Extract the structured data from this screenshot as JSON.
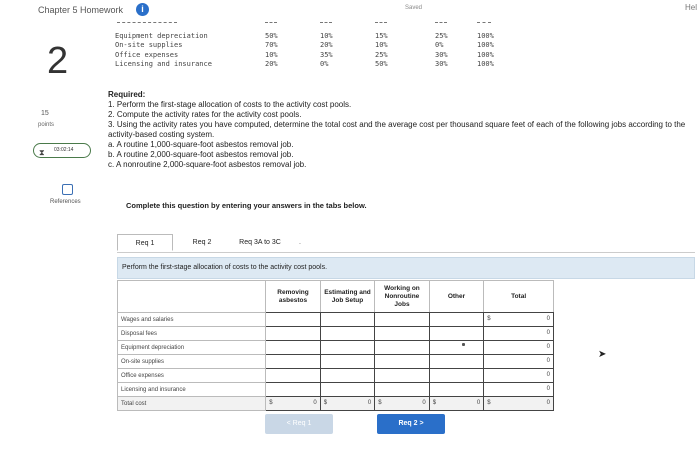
{
  "header": {
    "title": "Chapter 5 Homework",
    "info": "i",
    "status": "Saved",
    "help": "Hel"
  },
  "question": {
    "number": "2",
    "points_value": "15",
    "points_label": "points",
    "timer": "03:02:14",
    "references_label": "References"
  },
  "allocation_data": {
    "rows": [
      {
        "label": "Equipment depreciation",
        "values": [
          "50%",
          "10%",
          "15%",
          "25%",
          "100%"
        ]
      },
      {
        "label": "On-site supplies",
        "values": [
          "70%",
          "20%",
          "10%",
          "0%",
          "100%"
        ]
      },
      {
        "label": "Office expenses",
        "values": [
          "10%",
          "35%",
          "25%",
          "30%",
          "100%"
        ]
      },
      {
        "label": "Licensing and insurance",
        "values": [
          "20%",
          "0%",
          "50%",
          "30%",
          "100%"
        ]
      }
    ]
  },
  "required": {
    "title": "Required:",
    "items": [
      "1. Perform the first-stage allocation of costs to the activity cost pools.",
      "2. Compute the activity rates for the activity cost pools.",
      "3. Using the activity rates you have computed, determine the total cost and the average cost per thousand square feet of each of the following jobs according to the activity-based costing system.",
      "a. A routine 1,000-square-foot asbestos removal job.",
      "b. A routine 2,000-square-foot asbestos removal job.",
      "c. A nonroutine 2,000-square-foot asbestos removal job."
    ]
  },
  "instruction": "Complete this question by entering your answers in the tabs below.",
  "tabs": [
    "Req 1",
    "Req 2",
    "Req 3A to 3C"
  ],
  "task": "Perform the first-stage allocation of costs to the activity cost pools.",
  "table": {
    "headers": [
      "Removing asbestos",
      "Estimating and Job Setup",
      "Working on Nonroutine Jobs",
      "Other",
      "Total"
    ],
    "rows": [
      "Wages and salaries",
      "Disposal fees",
      "Equipment depreciation",
      "On-site supplies",
      "Office expenses",
      "Licensing and insurance"
    ],
    "first_row_total_symbol": "$",
    "row_totals": [
      "0",
      "0",
      "0",
      "0",
      "0",
      "0"
    ],
    "total_label": "Total cost",
    "total_symbol": "$",
    "total_values": [
      "0",
      "0",
      "0",
      "0",
      "0"
    ]
  },
  "nav": {
    "prev": "< Req 1",
    "next": "Req 2 >"
  },
  "colors": {
    "accent": "#2a6fc9",
    "task_bar": "#dde9f3"
  }
}
